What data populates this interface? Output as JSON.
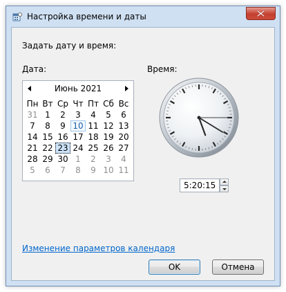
{
  "window": {
    "title": "Настройка времени и даты",
    "close_icon": "close-icon"
  },
  "prompt": "Задать дату и время:",
  "date_label": "Дата:",
  "time_label": "Время:",
  "calendar": {
    "month_year": "Июнь 2021",
    "weekdays": [
      "Пн",
      "Вт",
      "Ср",
      "Чт",
      "Пт",
      "Сб",
      "Вс"
    ],
    "weeks": [
      [
        "31",
        "1",
        "2",
        "3",
        "4",
        "5",
        "6"
      ],
      [
        "7",
        "8",
        "9",
        "10",
        "11",
        "12",
        "13"
      ],
      [
        "14",
        "15",
        "16",
        "17",
        "18",
        "19",
        "20"
      ],
      [
        "21",
        "22",
        "23",
        "24",
        "25",
        "26",
        "27"
      ],
      [
        "28",
        "29",
        "30",
        "1",
        "2",
        "3",
        "4"
      ],
      [
        "5",
        "6",
        "7",
        "8",
        "9",
        "10",
        "11"
      ]
    ],
    "today": "10",
    "selected": "23"
  },
  "time": {
    "value": "5:20:15",
    "hour": 5,
    "minute": 20,
    "second": 15
  },
  "calendar_settings_link": "Изменение параметров календаря",
  "buttons": {
    "ok": "OK",
    "cancel": "Отмена"
  },
  "colors": {
    "link": "#0066cc",
    "today": "#1d5ea8",
    "selected_bg": "#cde4fb",
    "close_button": "#c3402f"
  }
}
